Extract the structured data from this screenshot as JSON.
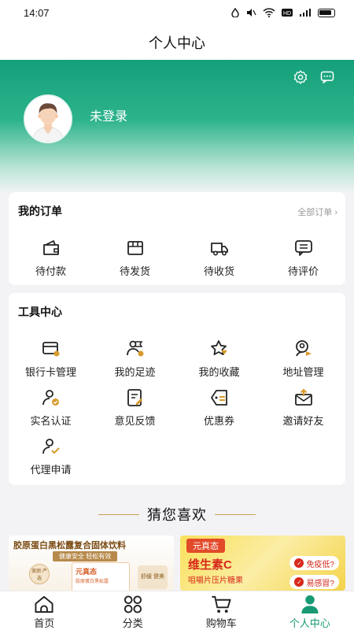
{
  "status_bar": {
    "time": "14:07",
    "icons": [
      "drop-icon",
      "mute-icon",
      "wifi-icon",
      "hd-icon",
      "signal-icon",
      "battery-icon"
    ]
  },
  "title": "个人中心",
  "user": {
    "login_text": "未登录"
  },
  "orders": {
    "title": "我的订单",
    "all_link": "全部订单 ›",
    "items": [
      {
        "label": "待付款",
        "icon": "wallet-icon"
      },
      {
        "label": "待发货",
        "icon": "package-icon"
      },
      {
        "label": "待收货",
        "icon": "truck-icon"
      },
      {
        "label": "待评价",
        "icon": "comment-icon"
      }
    ]
  },
  "tools": {
    "title": "工具中心",
    "items": [
      {
        "label": "银行卡管理",
        "icon": "bank-card-icon"
      },
      {
        "label": "我的足迹",
        "icon": "footprint-icon"
      },
      {
        "label": "我的收藏",
        "icon": "star-icon"
      },
      {
        "label": "地址管理",
        "icon": "location-icon"
      },
      {
        "label": "实名认证",
        "icon": "verify-user-icon"
      },
      {
        "label": "意见反馈",
        "icon": "feedback-icon"
      },
      {
        "label": "优惠券",
        "icon": "coupon-icon"
      },
      {
        "label": "邀请好友",
        "icon": "invite-icon"
      },
      {
        "label": "代理申请",
        "icon": "agent-icon"
      }
    ]
  },
  "guess": {
    "title": "猜您喜欢"
  },
  "products": [
    {
      "title": "胶原蛋白黑松露复合固体饮料",
      "slogan": "健康安全 轻松有效",
      "box_brand": "元真态",
      "box_sub": "胶原蛋白黑松露",
      "seal": "美丽 严选",
      "side": "舒缓 健美"
    },
    {
      "brand": "元真态",
      "name": "维生素C",
      "sub": "咀嚼片压片糖果",
      "tags": [
        "免疫低?",
        "易感冒?"
      ]
    }
  ],
  "tabbar": [
    {
      "label": "首页",
      "icon": "home-icon",
      "active": false
    },
    {
      "label": "分类",
      "icon": "category-icon",
      "active": false
    },
    {
      "label": "购物车",
      "icon": "cart-icon",
      "active": false
    },
    {
      "label": "个人中心",
      "icon": "user-icon",
      "active": true
    }
  ],
  "colors": {
    "accent": "#179a74",
    "icon_dark": "#222222",
    "icon_gold": "#d89a2c",
    "hero_top": "#14a07a"
  }
}
